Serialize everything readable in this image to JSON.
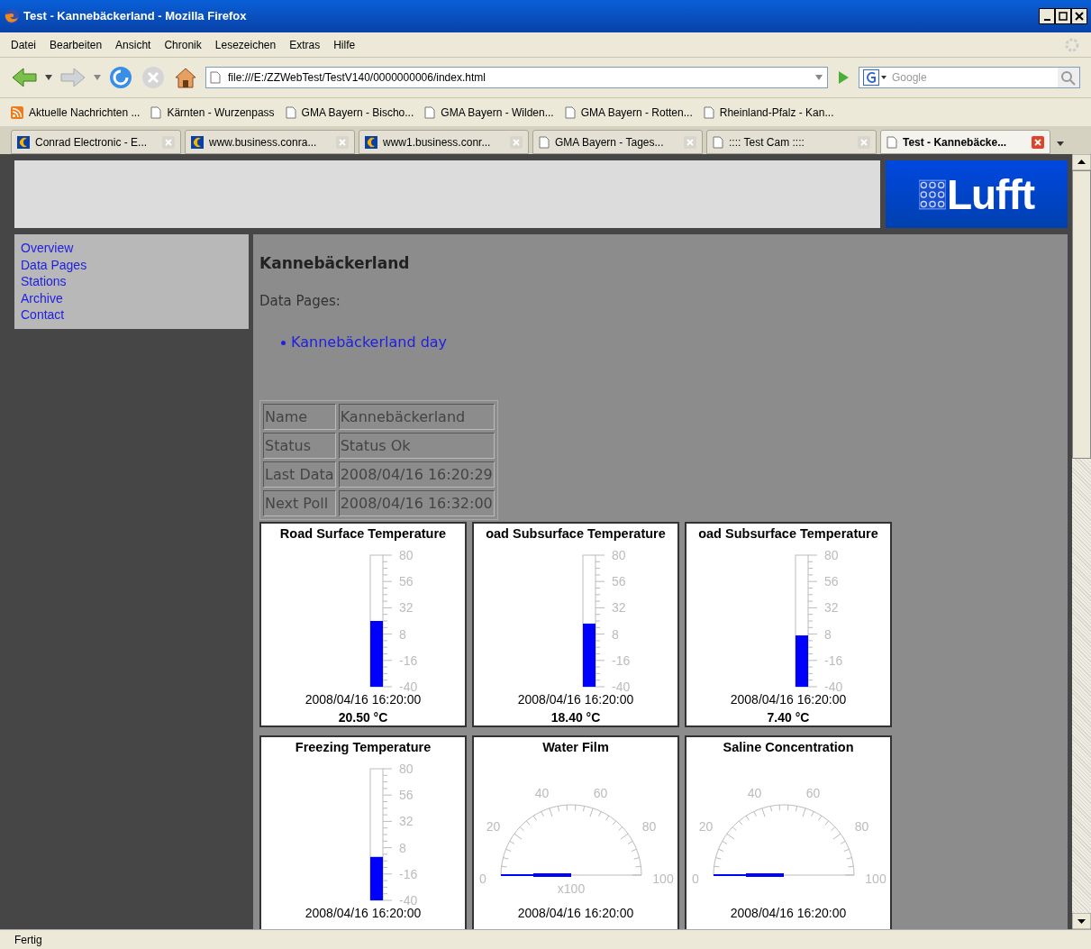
{
  "window": {
    "title": "Test - Kannebäckerland - Mozilla Firefox"
  },
  "menu": [
    "Datei",
    "Bearbeiten",
    "Ansicht",
    "Chronik",
    "Lesezeichen",
    "Extras",
    "Hilfe"
  ],
  "toolbar": {
    "url": "file:///E:/ZZWebTest/TestV140/0000000006/index.html",
    "search_placeholder": "Google"
  },
  "bookmarks": [
    {
      "label": "Aktuelle Nachrichten ...",
      "kind": "feed"
    },
    {
      "label": "Kärnten - Wurzenpass",
      "kind": "page"
    },
    {
      "label": "GMA Bayern - Bischo...",
      "kind": "page"
    },
    {
      "label": "GMA Bayern - Wilden...",
      "kind": "page"
    },
    {
      "label": "GMA Bayern - Rotten...",
      "kind": "page"
    },
    {
      "label": "Rheinland-Pfalz - Kan...",
      "kind": "page"
    }
  ],
  "tabs": [
    {
      "label": "Conrad Electronic - E...",
      "kind": "site",
      "selected": false
    },
    {
      "label": "www.business.conra...",
      "kind": "site",
      "selected": false
    },
    {
      "label": "www1.business.conr...",
      "kind": "site",
      "selected": false
    },
    {
      "label": "GMA Bayern - Tages...",
      "kind": "page",
      "selected": false
    },
    {
      "label": ":::: Test Cam ::::",
      "kind": "page",
      "selected": false
    },
    {
      "label": "Test - Kannebäcke...",
      "kind": "page",
      "selected": true
    }
  ],
  "page": {
    "logo": "Lufft",
    "sidebar": [
      "Overview",
      "Data Pages",
      "Stations",
      "Archive",
      "Contact"
    ],
    "heading": "Kannebäckerland",
    "section_label": "Data Pages:",
    "data_links": [
      "Kannebäckerland day"
    ],
    "info_table": [
      [
        "Name",
        "Kannebäckerland"
      ],
      [
        "Status",
        "Status Ok"
      ],
      [
        "Last Data",
        "2008/04/16 16:20:29"
      ],
      [
        "Next Poll",
        "2008/04/16 16:32:00"
      ]
    ],
    "gauges": [
      {
        "kind": "thermometer",
        "title": "Road Surface Temperature",
        "ticks": [
          "80",
          "56",
          "32",
          "8",
          "-16",
          "-40"
        ],
        "level": 0.5,
        "timestamp": "2008/04/16 16:20:00",
        "reading": "20.50 °C"
      },
      {
        "kind": "thermometer",
        "title": "oad Subsurface Temperature",
        "ticks": [
          "80",
          "56",
          "32",
          "8",
          "-16",
          "-40"
        ],
        "level": 0.48,
        "timestamp": "2008/04/16 16:20:00",
        "reading": "18.40 °C"
      },
      {
        "kind": "thermometer",
        "title": "oad Subsurface Temperature",
        "ticks": [
          "80",
          "56",
          "32",
          "8",
          "-16",
          "-40"
        ],
        "level": 0.39,
        "timestamp": "2008/04/16 16:20:00",
        "reading": "7.40 °C"
      },
      {
        "kind": "thermometer",
        "title": "Freezing Temperature",
        "ticks": [
          "80",
          "56",
          "32",
          "8",
          "-16",
          "-40"
        ],
        "level": 0.33,
        "timestamp": "2008/04/16 16:20:00"
      },
      {
        "kind": "dial",
        "title": "Water Film",
        "ticks": [
          "0",
          "20",
          "40",
          "60",
          "80",
          "100"
        ],
        "multiplier": "x100",
        "timestamp": "2008/04/16 16:20:00"
      },
      {
        "kind": "dial",
        "title": "Saline Concentration",
        "ticks": [
          "0",
          "20",
          "40",
          "60",
          "80",
          "100"
        ],
        "timestamp": "2008/04/16 16:20:00"
      }
    ]
  },
  "status_bar": "Fertig"
}
